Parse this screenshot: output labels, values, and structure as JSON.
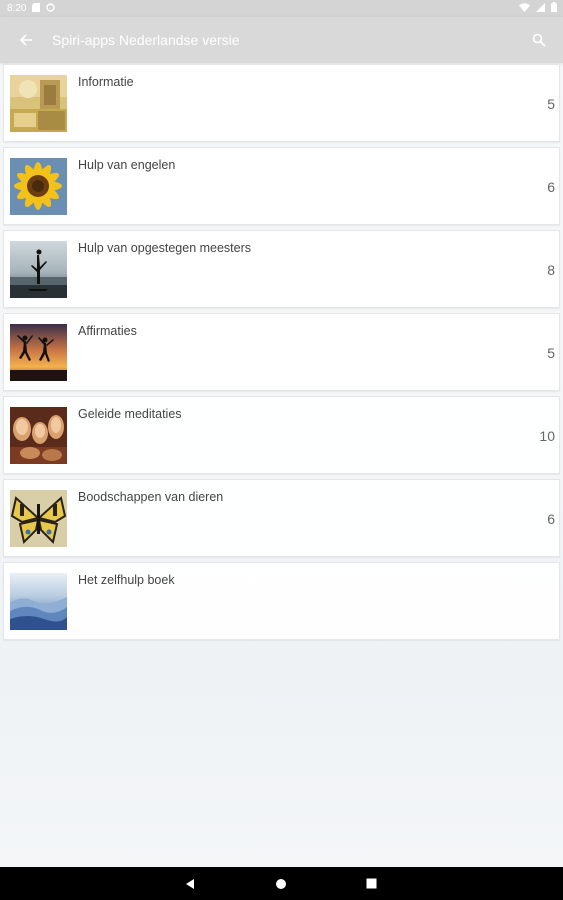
{
  "status_bar": {
    "time": "8:20",
    "icons": [
      "sd-card-icon",
      "sync-icon",
      "wifi-icon",
      "signal-icon",
      "battery-icon"
    ]
  },
  "app_bar": {
    "title": "Spiri-apps Nederlandse versie",
    "back_icon": "arrow-left-icon",
    "search_icon": "search-icon"
  },
  "categories": [
    {
      "label": "Informatie",
      "count": "5",
      "thumbnail": "collage-thumbnail"
    },
    {
      "label": "Hulp van engelen",
      "count": "6",
      "thumbnail": "sunflower-thumbnail"
    },
    {
      "label": "Hulp van opgestegen meesters",
      "count": "8",
      "thumbnail": "silhouette-lake-thumbnail"
    },
    {
      "label": "Affirmaties",
      "count": "5",
      "thumbnail": "jumping-silhouettes-sunset-thumbnail"
    },
    {
      "label": "Geleide meditaties",
      "count": "10",
      "thumbnail": "buddha-statues-thumbnail"
    },
    {
      "label": "Boodschappen van dieren",
      "count": "6",
      "thumbnail": "butterfly-thumbnail"
    },
    {
      "label": "Het zelfhulp boek",
      "count": "",
      "thumbnail": "misty-mountains-thumbnail"
    }
  ],
  "nav_bar": {
    "icons": [
      "back-triangle-icon",
      "home-circle-icon",
      "recents-square-icon"
    ]
  },
  "colors": {
    "app_bar": "#d9d9d9",
    "status_bar": "#d4d4d4",
    "nav_bar": "#000000"
  }
}
